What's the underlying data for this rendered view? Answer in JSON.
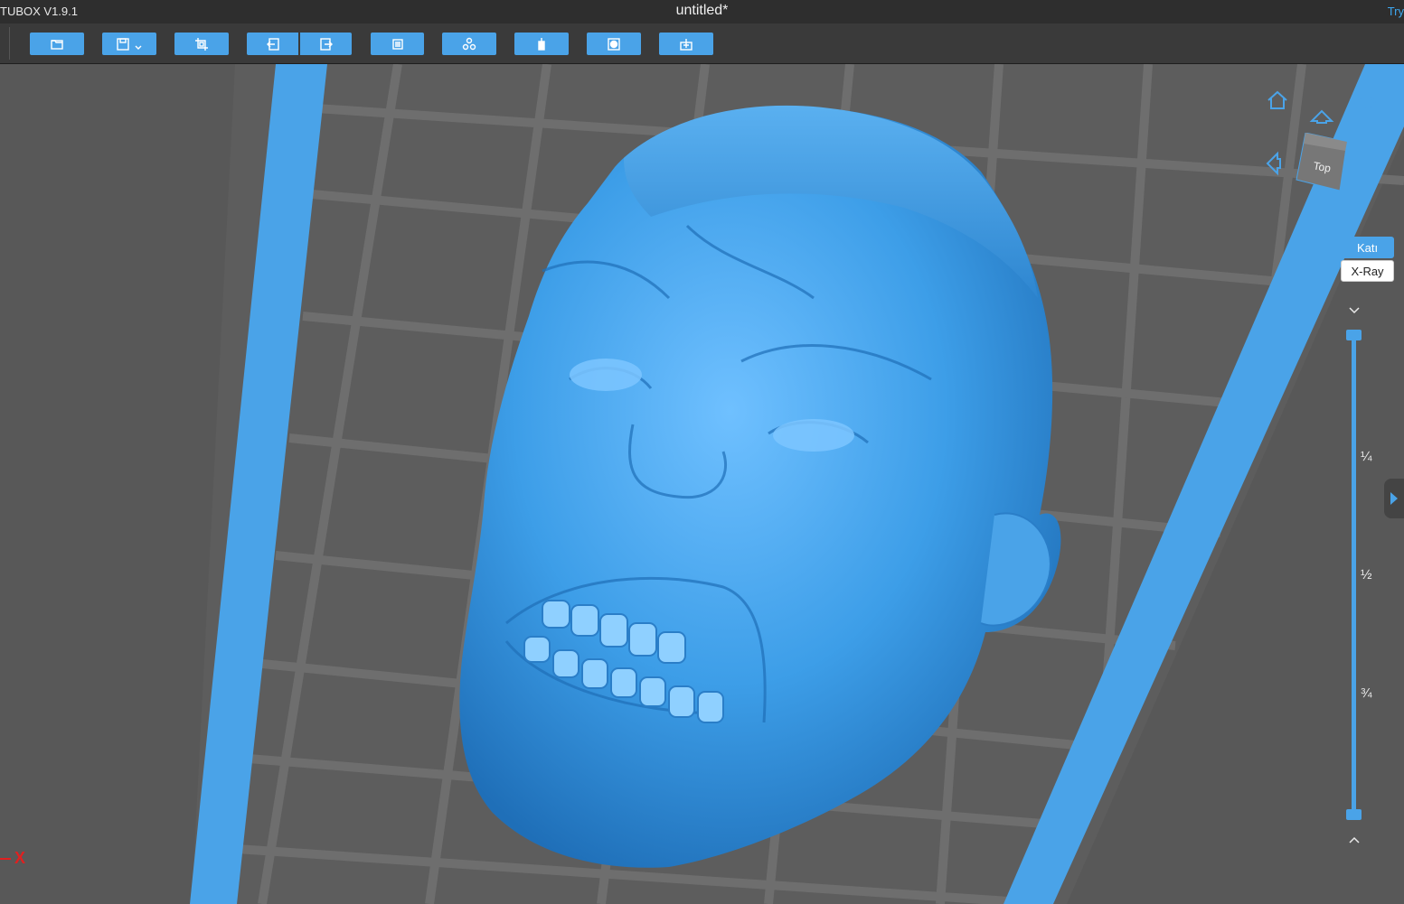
{
  "titlebar": {
    "app_name": "TUBOX V1.9.1",
    "document_title": "untitled*",
    "right_link": "Try"
  },
  "toolbar": {
    "buttons": [
      "open-folder",
      "save",
      "crop-select",
      "import",
      "export",
      "layers",
      "arrange",
      "support",
      "render",
      "add-model"
    ]
  },
  "viewport": {
    "model_color": "#4aa3e8",
    "bed_color": "#4aa3e8",
    "axis_label": "X",
    "view_cube_label": "Top",
    "display_modes": {
      "solid": "Katı",
      "xray": "X-Ray"
    },
    "slider": {
      "marks": [
        "¼",
        "½",
        "¾"
      ]
    }
  }
}
